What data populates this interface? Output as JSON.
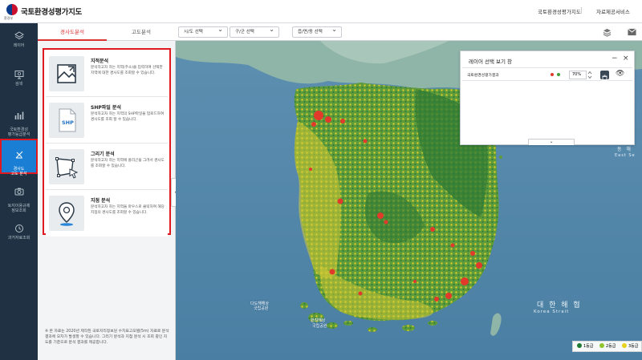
{
  "header": {
    "logo_sub": "환경부",
    "app_title": "국토환경성평가지도",
    "links": [
      "국토환경성평가지도",
      "자료제공서비스"
    ]
  },
  "sidebar": {
    "items": [
      {
        "label": "레이어",
        "icon": "layers-icon"
      },
      {
        "label": "검색",
        "icon": "search-monitor-icon"
      },
      {
        "label": "국토환경성\n평가등급분석",
        "icon": "bar-chart-icon"
      },
      {
        "label": "경사도\n고도 분석",
        "icon": "slope-icon",
        "active": true
      },
      {
        "label": "토지이용규제\n정보조회",
        "icon": "camera-icon"
      },
      {
        "label": "과거자료조회",
        "icon": "history-icon"
      }
    ]
  },
  "panel": {
    "tabs": [
      {
        "label": "경사도분석",
        "active": true
      },
      {
        "label": "고도분석",
        "active": false
      }
    ],
    "cards": [
      {
        "title": "지적분석",
        "icon": "map-area-icon",
        "desc": "분석하고자 하는 지역(주소)을 입력하여 선택한 지역에 대한 경사도를 조회할 수 있습니다."
      },
      {
        "title": "SHP파일 분석",
        "icon": "shp-file-icon",
        "icon_text": "SHP",
        "desc": "분석하고자 하는 지역의 SHP파일을 업로드하여 경사도를 조회 할 수 있습니다."
      },
      {
        "title": "그리기 분석",
        "icon": "draw-polygon-icon",
        "desc": "분석하고자 하는 지역에 폴리곤을 그려서 경사도를 조회할 수 있습니다."
      },
      {
        "title": "지점 분석",
        "icon": "location-pin-icon",
        "desc": "분석하고자 하는 지역을 마우스로 클릭하여 해당 지점의 경사도를 조회할 수 있습니다."
      }
    ],
    "note": "※ 본 자료는 2020년 제작된 국토지리정보원 수치표고모델(5m) 자료로 분석결과에 오차가 발생할 수 있습니다. 그리기 분석과 지점 분석 시 조회 중인 지도를 기준으로 분석 결과를 제공합니다."
  },
  "map_toolbar": {
    "selects": [
      "시/도 선택",
      "구/군 선택",
      "읍/면/동 선택"
    ]
  },
  "layer_window": {
    "title": "레이어 선택 보기 창",
    "layer_name": "국토환경성평가결과",
    "opacity": "70%"
  },
  "map": {
    "sea_labels": [
      "대 한 해 협",
      "Korea Strait",
      "동 해",
      "East Se"
    ],
    "place_labels": [
      "다도해해상",
      "국립공원",
      "한려해상",
      "국립공원"
    ]
  },
  "legend": {
    "items": [
      {
        "label": "1등급",
        "color": "#1e7a34"
      },
      {
        "label": "2등급",
        "color": "#8fc62c"
      },
      {
        "label": "3등급",
        "color": "#e8d21c"
      }
    ]
  }
}
